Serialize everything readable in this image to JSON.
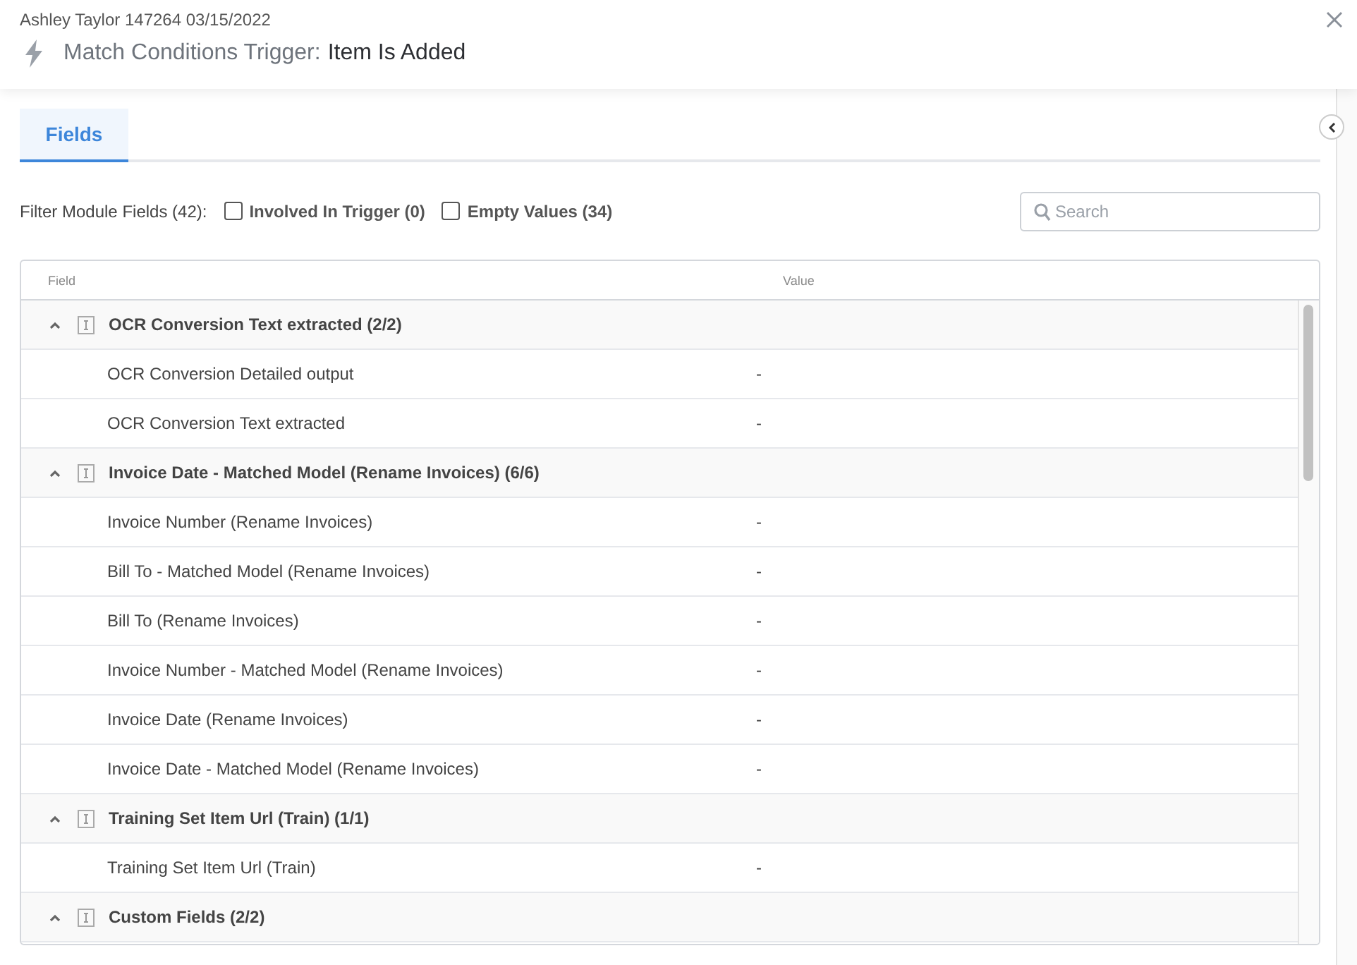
{
  "header": {
    "subtitle": "Ashley Taylor 147264 03/15/2022",
    "title_label": "Match Conditions Trigger:",
    "title_value": "Item Is Added"
  },
  "tabs": [
    {
      "label": "Fields",
      "selected": true
    }
  ],
  "filter": {
    "label": "Filter Module Fields (42):",
    "options": [
      {
        "label": "Involved In Trigger (0)",
        "checked": false
      },
      {
        "label": "Empty Values (34)",
        "checked": false
      }
    ]
  },
  "search": {
    "placeholder": "Search"
  },
  "table": {
    "columns": [
      "Field",
      "Value"
    ],
    "groups": [
      {
        "name": "OCR Conversion Text extracted (2/2)",
        "expanded": true,
        "rows": [
          {
            "field": "OCR Conversion Detailed output",
            "value": "-"
          },
          {
            "field": "OCR Conversion Text extracted",
            "value": "-"
          }
        ]
      },
      {
        "name": "Invoice Date - Matched Model (Rename Invoices) (6/6)",
        "expanded": true,
        "rows": [
          {
            "field": "Invoice Number (Rename Invoices)",
            "value": "-"
          },
          {
            "field": "Bill To - Matched Model (Rename Invoices)",
            "value": "-"
          },
          {
            "field": "Bill To (Rename Invoices)",
            "value": "-"
          },
          {
            "field": "Invoice Number - Matched Model (Rename Invoices)",
            "value": "-"
          },
          {
            "field": "Invoice Date (Rename Invoices)",
            "value": "-"
          },
          {
            "field": "Invoice Date - Matched Model (Rename Invoices)",
            "value": "-"
          }
        ]
      },
      {
        "name": "Training Set Item Url (Train) (1/1)",
        "expanded": true,
        "rows": [
          {
            "field": "Training Set Item Url (Train)",
            "value": "-"
          }
        ]
      },
      {
        "name": "Custom Fields (2/2)",
        "expanded": true
      }
    ]
  }
}
